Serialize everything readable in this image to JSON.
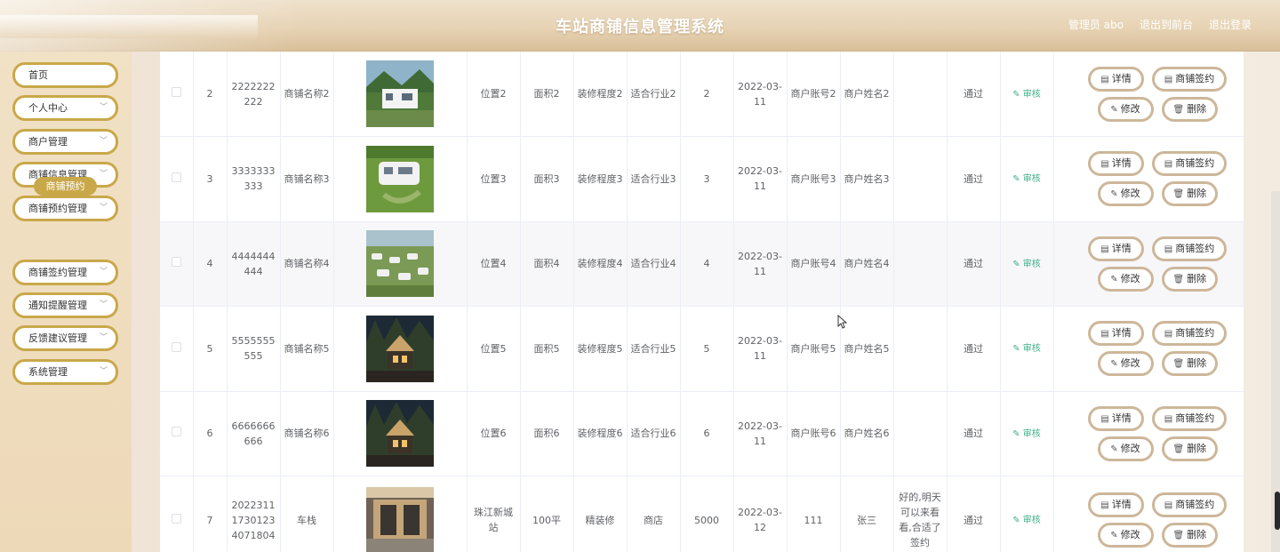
{
  "header": {
    "title": "车站商铺信息管理系统",
    "admin_label": "管理员 abo",
    "to_front": "退出到前台",
    "logout": "退出登录"
  },
  "sidebar": {
    "items": [
      {
        "label": "首页",
        "has_chevron": false
      },
      {
        "label": "个人中心",
        "has_chevron": true
      },
      {
        "label": "商户管理",
        "has_chevron": true
      },
      {
        "label": "商铺信息管理",
        "has_chevron": true
      },
      {
        "label": "商铺预约管理",
        "has_chevron": true
      },
      {
        "label": "商铺签约管理",
        "has_chevron": true
      },
      {
        "label": "通知提醒管理",
        "has_chevron": true
      },
      {
        "label": "反馈建议管理",
        "has_chevron": true
      },
      {
        "label": "系统管理",
        "has_chevron": true
      }
    ],
    "sub_item": "商铺预约"
  },
  "buttons": {
    "detail": "详情",
    "sign": "商铺签约",
    "edit": "修改",
    "delete": "删除",
    "audit": "审核"
  },
  "rows": [
    {
      "index": "2",
      "code": "2222222222",
      "name": "商铺名称2",
      "image": "house-green",
      "location": "位置2",
      "area": "面积2",
      "decor": "装修程度2",
      "industry": "适合行业2",
      "price": "2",
      "date": "2022-03-11",
      "account": "商户账号2",
      "owner": "商户姓名2",
      "reply": "",
      "status": "通过"
    },
    {
      "index": "3",
      "code": "3333333333",
      "name": "商铺名称3",
      "image": "lawn-caravan",
      "location": "位置3",
      "area": "面积3",
      "decor": "装修程度3",
      "industry": "适合行业3",
      "price": "3",
      "date": "2022-03-11",
      "account": "商户账号3",
      "owner": "商户姓名3",
      "reply": "",
      "status": "通过"
    },
    {
      "index": "4",
      "code": "4444444444",
      "name": "商铺名称4",
      "image": "camp-field",
      "location": "位置4",
      "area": "面积4",
      "decor": "装修程度4",
      "industry": "适合行业4",
      "price": "4",
      "date": "2022-03-11",
      "account": "商户账号4",
      "owner": "商户姓名4",
      "reply": "",
      "status": "通过"
    },
    {
      "index": "5",
      "code": "5555555555",
      "name": "商铺名称5",
      "image": "night-cabins",
      "location": "位置5",
      "area": "面积5",
      "decor": "装修程度5",
      "industry": "适合行业5",
      "price": "5",
      "date": "2022-03-11",
      "account": "商户账号5",
      "owner": "商户姓名5",
      "reply": "",
      "status": "通过"
    },
    {
      "index": "6",
      "code": "6666666666",
      "name": "商铺名称6",
      "image": "night-cabins",
      "location": "位置6",
      "area": "面积6",
      "decor": "装修程度6",
      "industry": "适合行业6",
      "price": "6",
      "date": "2022-03-11",
      "account": "商户账号6",
      "owner": "商户姓名6",
      "reply": "",
      "status": "通过"
    },
    {
      "index": "7",
      "code": "202231117301234071804",
      "name": "车栈",
      "image": "station-hall",
      "location": "珠江新城站",
      "area": "100平",
      "decor": "精装修",
      "industry": "商店",
      "price": "5000",
      "date": "2022-03-12",
      "account": "111",
      "owner": "张三",
      "reply": "好的,明天可以来看看,合适了签约",
      "status": "通过"
    }
  ],
  "colors": {
    "menu_border": "#c9a84a",
    "button_border": "#cdb79a",
    "audit_text": "#3fae8a",
    "header_bg": "#e7d3b4"
  }
}
